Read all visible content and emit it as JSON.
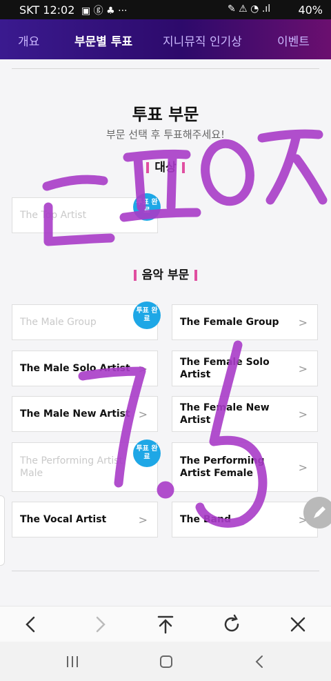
{
  "status_bar": {
    "carrier_time": "SKT 12:02",
    "battery": "40%"
  },
  "tabs": [
    {
      "label": "개요"
    },
    {
      "label": "부문별 투표"
    },
    {
      "label": "지니뮤직 인기상"
    },
    {
      "label": "이벤트"
    }
  ],
  "header": {
    "title": "투표 부문",
    "subtitle": "부문 선택 후 투표해주세요!"
  },
  "grand_prize": {
    "section_label": "대상",
    "card_label": "The Top Artist",
    "badge": "투표 완료"
  },
  "music": {
    "section_label": "음악 부문",
    "cards": [
      {
        "label": "The Male Group",
        "done": true,
        "badge": "투표 완료"
      },
      {
        "label": "The Female Group",
        "done": false
      },
      {
        "label": "The Male Solo Artist",
        "done": false
      },
      {
        "label": "The Female Solo Artist",
        "done": false
      },
      {
        "label": "The Male New Artist",
        "done": false
      },
      {
        "label": "The Female New Artist",
        "done": false
      },
      {
        "label": "The Performing Artist Male",
        "done": true,
        "badge": "투표 완료"
      },
      {
        "label": "The Performing Artist Female",
        "done": false
      },
      {
        "label": "The Vocal Artist",
        "done": false
      },
      {
        "label": "The Band",
        "done": false
      }
    ]
  },
  "colors": {
    "accent": "#e04fa0",
    "badge": "#1ea7e6",
    "scribble": "#a93cc8"
  }
}
